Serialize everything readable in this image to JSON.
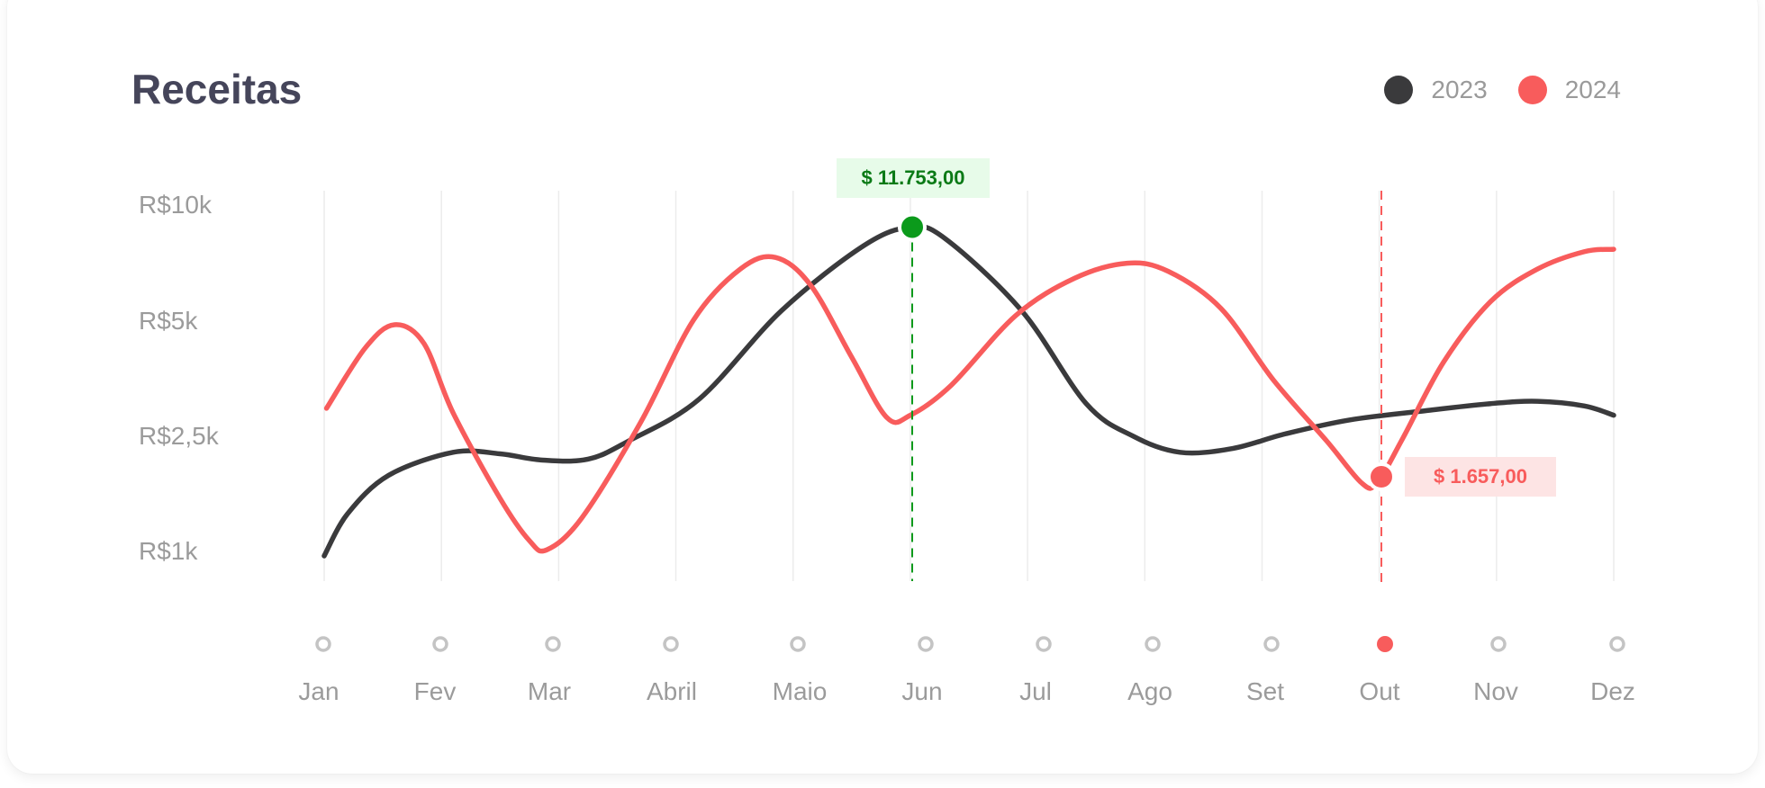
{
  "card": {
    "title": "Receitas"
  },
  "legend": [
    {
      "label": "2023",
      "color": "#3a3a3c"
    },
    {
      "label": "2024",
      "color": "#f85c5c"
    }
  ],
  "chart_data": {
    "type": "line",
    "title": "Receitas",
    "categories": [
      "Jan",
      "Fev",
      "Mar",
      "Abril",
      "Maio",
      "Jun",
      "Jul",
      "Ago",
      "Set",
      "Out",
      "Nov",
      "Dez"
    ],
    "y_tick_labels": [
      "R$10k",
      "R$5k",
      "R$2,5k",
      "R$1k"
    ],
    "y_scale": "categorical-ticks",
    "grid": {
      "vertical": true,
      "horizontal": false
    },
    "legend_position": "top-right",
    "series": [
      {
        "name": "2023",
        "color": "#3a3a3c",
        "curve": "smooth",
        "points": [
          [
            0,
            1000
          ],
          [
            0.2,
            1550
          ],
          [
            0.55,
            2050
          ],
          [
            1.1,
            2350
          ],
          [
            1.5,
            2330
          ],
          [
            1.85,
            2250
          ],
          [
            2.25,
            2260
          ],
          [
            2.6,
            2500
          ],
          [
            3.2,
            3400
          ],
          [
            3.9,
            5600
          ],
          [
            4.6,
            8400
          ],
          [
            5.0,
            9200
          ],
          [
            5.3,
            8700
          ],
          [
            5.95,
            5600
          ],
          [
            6.5,
            3300
          ],
          [
            6.9,
            2600
          ],
          [
            7.3,
            2350
          ],
          [
            7.75,
            2400
          ],
          [
            8.2,
            2650
          ],
          [
            8.75,
            2950
          ],
          [
            9.4,
            3150
          ],
          [
            9.95,
            3300
          ],
          [
            10.35,
            3350
          ],
          [
            10.75,
            3250
          ],
          [
            11.0,
            3050
          ]
        ]
      },
      {
        "name": "2024",
        "color": "#f85c5c",
        "curve": "smooth",
        "points": [
          [
            0.02,
            3200
          ],
          [
            0.35,
            4500
          ],
          [
            0.6,
            5000
          ],
          [
            0.85,
            4600
          ],
          [
            1.1,
            3100
          ],
          [
            1.5,
            1750
          ],
          [
            1.75,
            1200
          ],
          [
            1.9,
            1080
          ],
          [
            2.2,
            1500
          ],
          [
            2.7,
            2900
          ],
          [
            3.15,
            5200
          ],
          [
            3.55,
            7400
          ],
          [
            3.85,
            7900
          ],
          [
            4.15,
            6700
          ],
          [
            4.5,
            4300
          ],
          [
            4.8,
            3000
          ],
          [
            5.0,
            3050
          ],
          [
            5.35,
            3700
          ],
          [
            5.9,
            5400
          ],
          [
            6.4,
            7000
          ],
          [
            6.85,
            7650
          ],
          [
            7.2,
            7300
          ],
          [
            7.65,
            5700
          ],
          [
            8.1,
            3800
          ],
          [
            8.55,
            2500
          ],
          [
            8.85,
            1950
          ],
          [
            8.98,
            1950
          ],
          [
            9.2,
            2550
          ],
          [
            9.55,
            4200
          ],
          [
            9.95,
            6000
          ],
          [
            10.35,
            7400
          ],
          [
            10.75,
            8150
          ],
          [
            11.0,
            8250
          ]
        ]
      }
    ],
    "highlights": [
      {
        "series": "2023",
        "category": "Jun",
        "label": "$ 11.753,00",
        "color": "#0b9a1b"
      },
      {
        "series": "2024",
        "category": "Out",
        "label": "$ 1.657,00",
        "color": "#f85c5c"
      }
    ],
    "selected_category": "Out"
  },
  "colors": {
    "grid": "#ececec",
    "axis_text": "#9b9b9b",
    "marker_ring": "#c4c4c4",
    "highlight_green_bg": "#e7fbe9",
    "highlight_green_text": "#0b7a16",
    "highlight_red_bg": "#fde4e4",
    "highlight_red_text": "#f85c5c"
  }
}
